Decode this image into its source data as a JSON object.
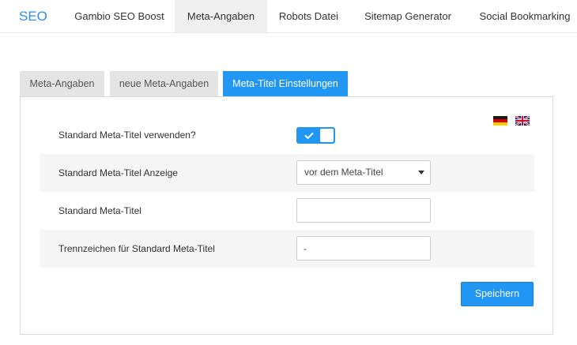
{
  "topnav": {
    "brand": "SEO",
    "items": [
      {
        "label": "Gambio SEO Boost",
        "active": false
      },
      {
        "label": "Meta-Angaben",
        "active": true
      },
      {
        "label": "Robots Datei",
        "active": false
      },
      {
        "label": "Sitemap Generator",
        "active": false
      },
      {
        "label": "Social Bookmarking",
        "active": false
      }
    ]
  },
  "tabs": [
    {
      "label": "Meta-Angaben",
      "active": false
    },
    {
      "label": "neue Meta-Angaben",
      "active": false
    },
    {
      "label": "Meta-Titel Einstellungen",
      "active": true
    }
  ],
  "languages": [
    {
      "code": "de",
      "icon": "flag-germany-icon"
    },
    {
      "code": "en",
      "icon": "flag-uk-icon"
    }
  ],
  "form": {
    "use_default_title": {
      "label": "Standard Meta-Titel verwenden?",
      "checked": true
    },
    "title_display": {
      "label": "Standard Meta-Titel Anzeige",
      "value": "vor dem Meta-Titel"
    },
    "default_title": {
      "label": "Standard Meta-Titel",
      "value": ""
    },
    "separator": {
      "label": "Trennzeichen für Standard Meta-Titel",
      "value": "-"
    }
  },
  "actions": {
    "save_label": "Speichern"
  },
  "colors": {
    "accent": "#2196f3",
    "brand": "#2e8fe3",
    "tab_inactive": "#e4e4e4",
    "row_shade": "#f5f5f5"
  }
}
